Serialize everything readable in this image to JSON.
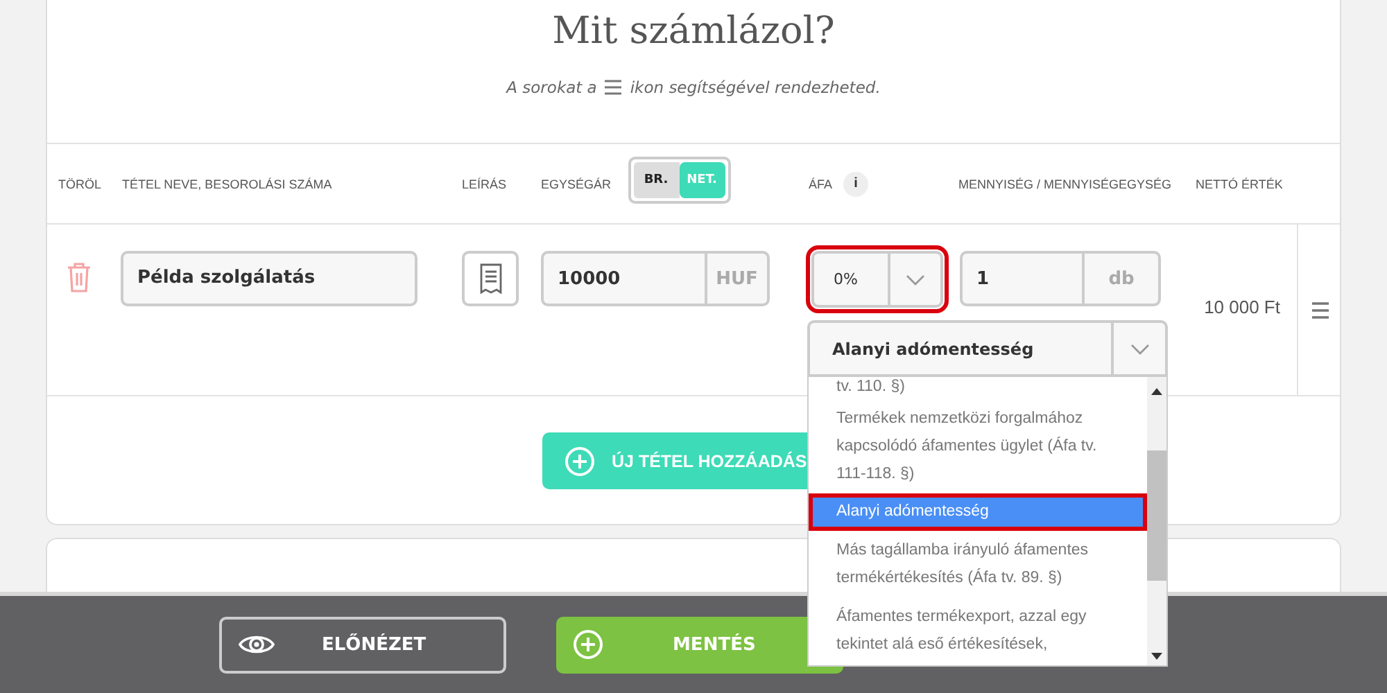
{
  "title": "Mit számlázol?",
  "hint": {
    "before": "A sorokat a",
    "after": "ikon segítségével rendezheted."
  },
  "columns": [
    {
      "label": "TÖRÖL"
    },
    {
      "label": "TÉTEL NEVE, BESOROLÁSI SZÁMA"
    },
    {
      "label": "LEÍRÁS"
    },
    {
      "label": "EGYSÉGÁR",
      "options": [
        {
          "label": "BR.",
          "selected": false
        },
        {
          "label": "NET.",
          "selected": true
        }
      ]
    },
    {
      "label": "ÁFA",
      "info": "i"
    },
    {
      "label": "MENNYISÉG / MENNYISÉGEGYSÉG"
    },
    {
      "label": "NETTÓ ÉRTÉK"
    }
  ],
  "item": {
    "name": "Példa szolgálatás",
    "unit_price": "10000",
    "currency": "HUF",
    "vat": {
      "value": "0%",
      "highlighted": true
    },
    "quantity": "1",
    "unit": "db",
    "net_value": "10 000 Ft"
  },
  "vat_reason": {
    "value": "Alanyi adómentesség",
    "options": [
      {
        "text": "tv. 110. §)",
        "selected": false,
        "highlighted": false
      },
      {
        "text": "Termékek nemzetközi forgalmához kapcsolódó áfamentes ügylet (Áfa tv. 111-118. §)",
        "selected": false,
        "highlighted": false
      },
      {
        "text": "Alanyi adómentesség",
        "selected": true,
        "highlighted": true
      },
      {
        "text": "Más tagállamba irányuló áfamentes termékértékesítés (Áfa tv. 89. §)",
        "selected": false,
        "highlighted": false
      },
      {
        "text": "Áfamentes termékexport, azzal egy tekintet alá eső értékesítések,",
        "selected": false,
        "highlighted": false
      }
    ]
  },
  "add_button": "ÚJ TÉTEL HOZZÁADÁS",
  "footer": {
    "preview_button": "ELŐNÉZET",
    "save_button": "MENTÉS"
  }
}
